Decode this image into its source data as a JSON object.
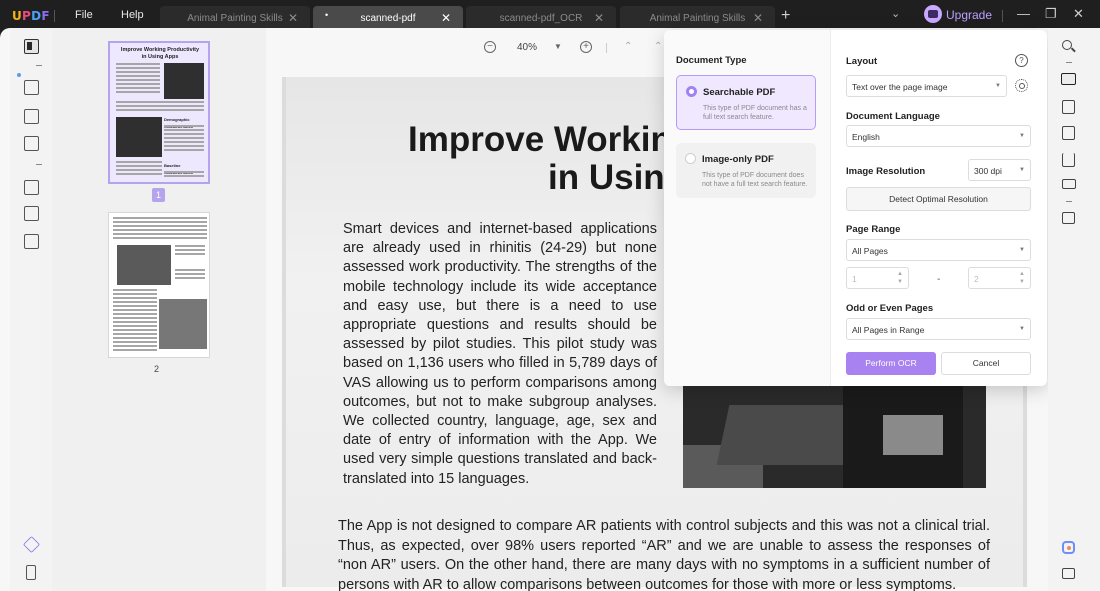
{
  "app": {
    "logo": "UPDF"
  },
  "menu": {
    "file": "File",
    "help": "Help"
  },
  "tabs": [
    {
      "label": "Animal Painting Skills",
      "active": false
    },
    {
      "label": "scanned-pdf",
      "active": true
    },
    {
      "label": "scanned-pdf_OCR",
      "active": false
    },
    {
      "label": "Animal Painting Skills",
      "active": false
    }
  ],
  "titlebar": {
    "upgrade_label": "Upgrade"
  },
  "zoom": {
    "value": "40%"
  },
  "thumbnails": {
    "page1_number": "1",
    "page2_number": "2",
    "page1_title": "Improve Working Productivity in Using Apps",
    "page1_section": "Demographic Characteristics",
    "page1_section2": "Baseline Characteristics"
  },
  "document": {
    "title_line1": "Improve Workin",
    "title_line2": "in Usin",
    "paragraph1": "Smart devices and internet-based applications are already used in rhinitis (24-29) but none assessed work productivity. The strengths of the mobile technology include its wide acceptance and easy use, but there is a need to use appropriate questions and results should be assessed by pilot studies. This pilot study was based on 1,136 users who filled in 5,789 days of VAS allowing us to perform comparisons among outcomes, but not to make subgroup analyses. We collected country, language, age, sex and date of entry of information with the App. We used very simple questions translated and back-translated into 15 languages.",
    "paragraph2": "The App is not designed to compare AR patients with control subjects and this was not a clinical trial. Thus, as expected, over 98% users reported “AR” and we are unable to assess the responses of “non AR” users. On the other hand, there are many days with no symptoms in a sufficient number of persons with AR to allow comparisons between outcomes for those with more or less symptoms."
  },
  "ocr": {
    "document_type_heading": "Document Type",
    "searchable": {
      "name": "Searchable PDF",
      "desc": "This type of PDF document has a full text search feature."
    },
    "image_only": {
      "name": "Image-only PDF",
      "desc": "This type of PDF document does not have a full text search feature."
    },
    "layout_heading": "Layout",
    "layout_value": "Text over the page image",
    "language_heading": "Document Language",
    "language_value": "English",
    "resolution_heading": "Image Resolution",
    "resolution_value": "300 dpi",
    "detect_button": "Detect Optimal Resolution",
    "page_range_heading": "Page Range",
    "page_range_value": "All Pages",
    "range_from": "1",
    "range_sep": "-",
    "range_to": "2",
    "odd_even_heading": "Odd or Even Pages",
    "odd_even_value": "All Pages in Range",
    "perform_button": "Perform OCR",
    "cancel_button": "Cancel"
  },
  "colors": {
    "accent": "#a882f0",
    "accent_light": "#efe8ff",
    "titlebar": "#1f1f1f"
  }
}
